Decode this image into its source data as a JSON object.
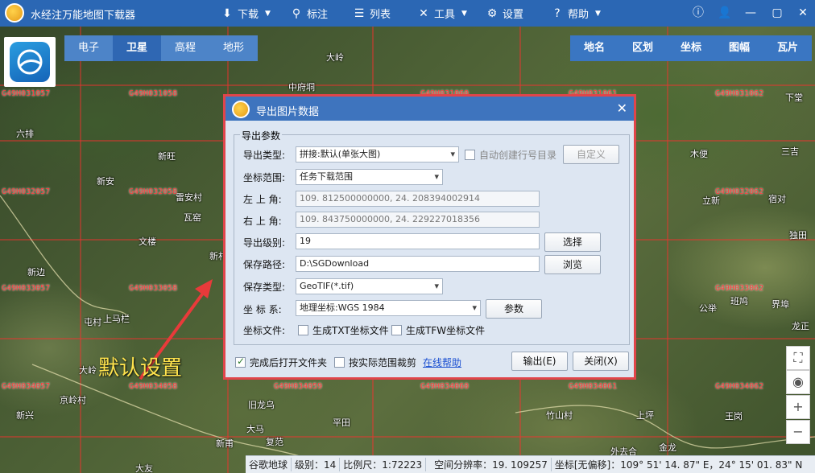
{
  "app": {
    "title": "水经注万能地图下载器"
  },
  "menu": [
    {
      "label": "下载",
      "icon": "download-icon",
      "caret": true
    },
    {
      "label": "标注",
      "icon": "pin-icon",
      "caret": false
    },
    {
      "label": "列表",
      "icon": "list-icon",
      "caret": false
    },
    {
      "label": "工具",
      "icon": "tools-icon",
      "caret": true
    },
    {
      "label": "设置",
      "icon": "gear-icon",
      "caret": false
    },
    {
      "label": "帮助",
      "icon": "help-icon",
      "caret": true
    }
  ],
  "map_tabs_left": [
    "电子",
    "卫星",
    "高程",
    "地形"
  ],
  "map_tabs_left_active": "卫星",
  "map_tabs_right": [
    "地名",
    "区划",
    "坐标",
    "图幅",
    "瓦片"
  ],
  "places": [
    "大岭",
    "中府垌",
    "六排",
    "新旺",
    "新安",
    "雷安村",
    "瓦窑",
    "文楼",
    "新村",
    "新边",
    "上马栏",
    "屯村",
    "大岭",
    "京岭村",
    "新兴",
    "旧龙乌",
    "平田",
    "大马",
    "新甫",
    "复范",
    "竹山村",
    "上坪",
    "木便",
    "三吉",
    "立新",
    "宿对",
    "独田",
    "公举",
    "班鸠",
    "界埠",
    "龙正",
    "王岗",
    "金龙",
    "大友",
    "外去合",
    "下堂"
  ],
  "grid_codes": [
    "G49H031057",
    "G49H031058",
    "G49H031060",
    "G49H031061",
    "G49H031062",
    "G49H032057",
    "G49H032058",
    "G49H032062",
    "G49H033057",
    "G49H033058",
    "G49H033062",
    "G49H034057",
    "G49H034058",
    "G49H034059",
    "G49H034060",
    "G49H034061",
    "G49H034062"
  ],
  "annotation": "默认设置",
  "status": {
    "source": "谷歌地球",
    "level": "级别：14",
    "scale": "比例尺：1:72223",
    "resolution": "空间分辨率：19. 109257",
    "coords": "坐标[无偏移]：109° 51' 14. 87\" E，24° 15' 01. 83\" N"
  },
  "dialog": {
    "title": "导出图片数据",
    "group_title": "导出参数",
    "export_type_label": "导出类型:",
    "export_type_value": "拼接:默认(单张大图)",
    "auto_dir_label": "自动创建行号目录",
    "custom_button": "自定义",
    "coord_range_label": "坐标范围:",
    "coord_range_value": "任务下载范围",
    "top_left_label": "左 上 角:",
    "top_left_value": "109. 812500000000, 24. 208394002914",
    "bottom_right_label": "右 上 角:",
    "bottom_right_value": "109. 843750000000, 24. 229227018356",
    "level_label": "导出级别:",
    "level_value": "19",
    "select_button": "选择",
    "path_label": "保存路径:",
    "path_value": "D:\\SGDownload",
    "browse_button": "浏览",
    "save_type_label": "保存类型:",
    "save_type_value": "GeoTIF(*.tif)",
    "crs_label": "坐 标 系:",
    "crs_value": "地理坐标:WGS 1984",
    "params_button": "参数",
    "coord_file_label": "坐标文件:",
    "gen_txt_label": "生成TXT坐标文件",
    "gen_tfw_label": "生成TFW坐标文件",
    "open_folder_label": "完成后打开文件夹",
    "open_folder_checked": true,
    "crop_label": "按实际范围裁剪",
    "help_link": "在线帮助",
    "export_button": "输出(E)",
    "close_button": "关闭(X)"
  }
}
